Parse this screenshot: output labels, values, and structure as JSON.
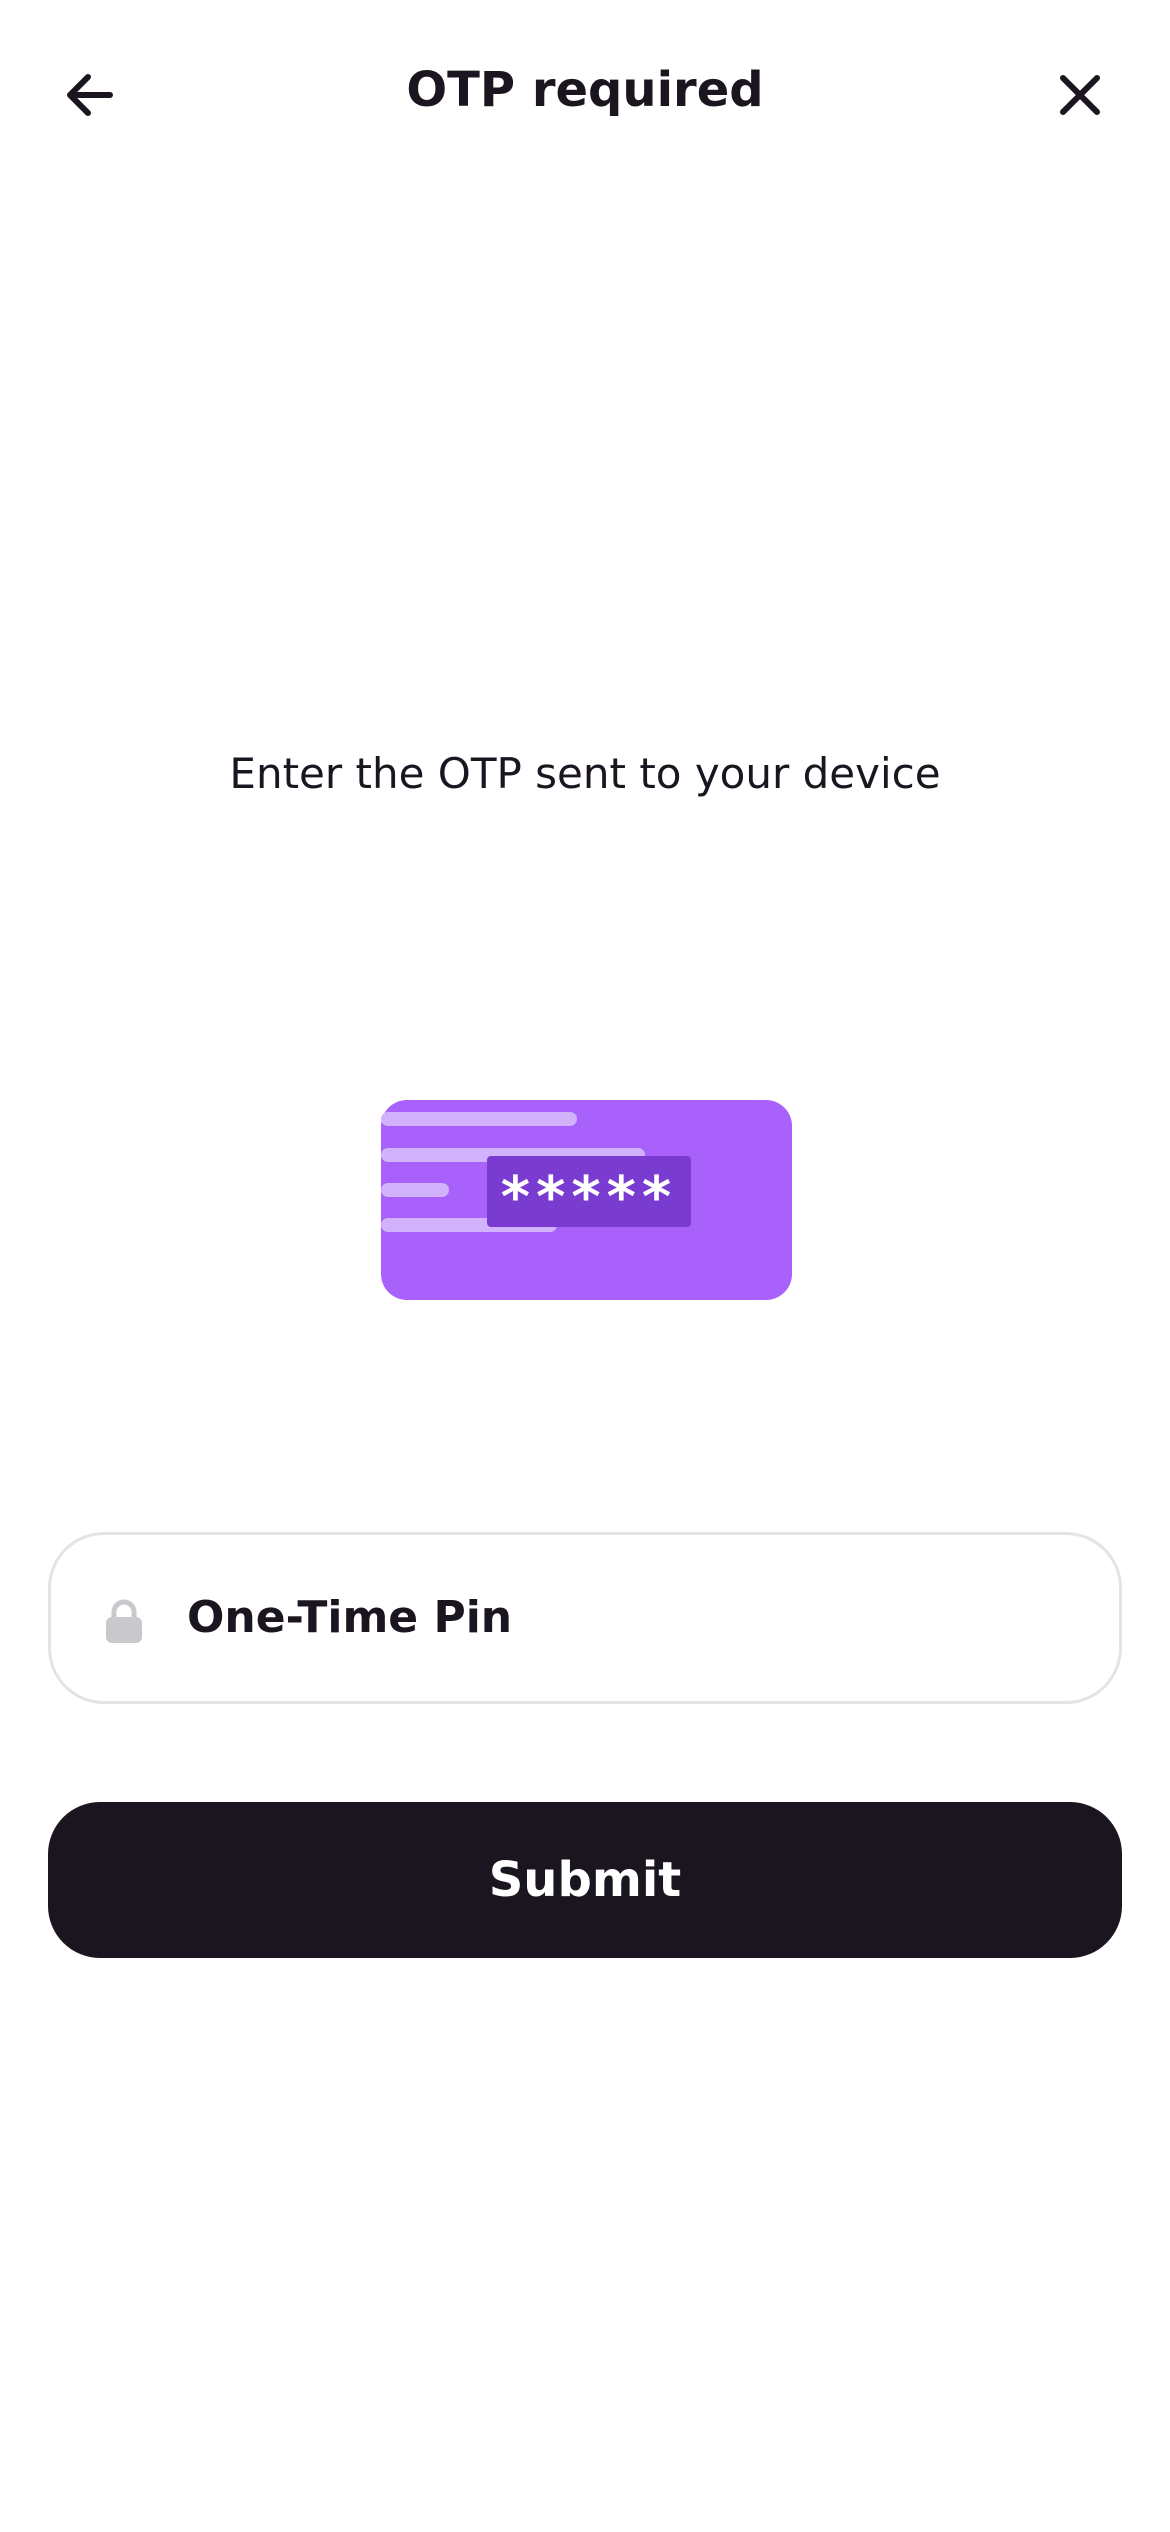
{
  "header": {
    "title": "OTP required",
    "back_icon": "arrow-left-icon",
    "close_icon": "close-icon"
  },
  "main": {
    "instruction": "Enter the OTP sent to your device",
    "illustration": {
      "masked_text": "*****",
      "card_color": "#a862fb",
      "mask_color": "#7a3bd0"
    },
    "otp_field": {
      "label": "One-Time Pin",
      "icon": "lock-icon",
      "value": ""
    },
    "submit_label": "Submit"
  },
  "colors": {
    "primary_text": "#1b1520",
    "button_background": "#1b1520",
    "field_border": "#e4e3e6",
    "icon_muted": "#c9c8cd"
  }
}
